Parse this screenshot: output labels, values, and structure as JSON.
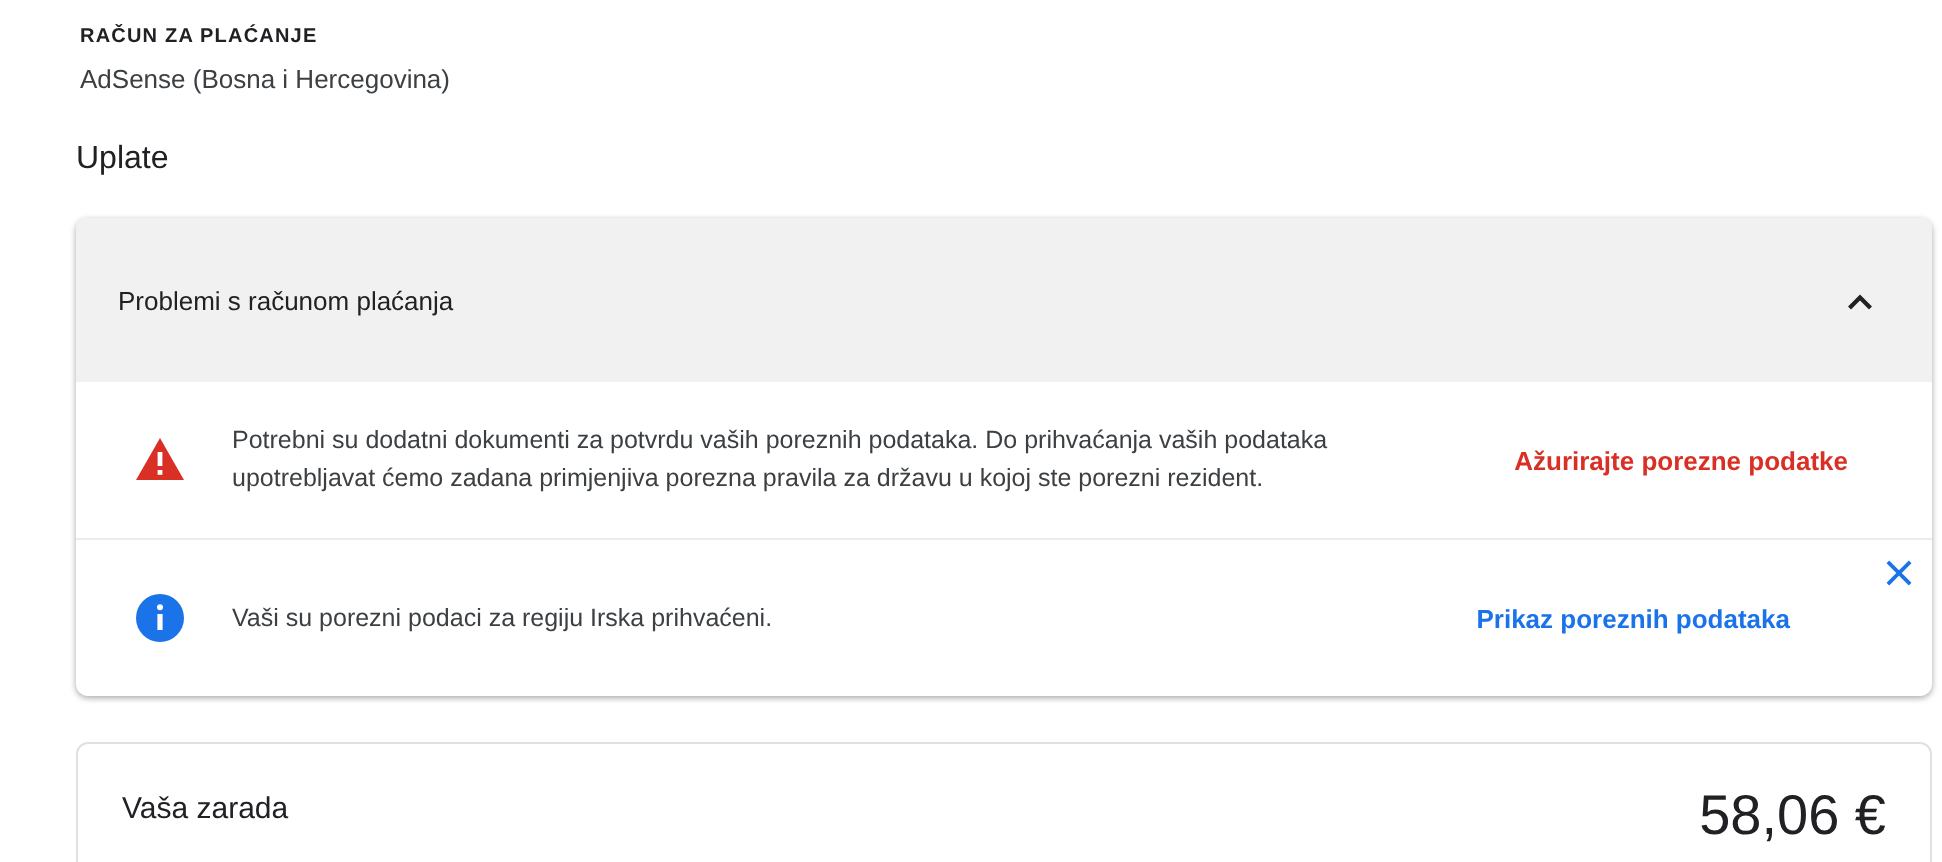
{
  "account": {
    "label": "RAČUN ZA PLAĆANJE",
    "name": "AdSense (Bosna i Hercegovina)"
  },
  "section_title": "Uplate",
  "issues_panel": {
    "title": "Problemi s računom plaćanja",
    "expanded": true,
    "alerts": [
      {
        "kind": "warning",
        "message": "Potrebni su dodatni dokumenti za potvrdu vaših poreznih podataka. Do prihvaćanja vaših podataka upotrebljavat ćemo zadana primjenjiva porezna pravila za državu u kojoj ste porezni rezident.",
        "action": "Ažurirajte porezne podatke",
        "dismissible": false
      },
      {
        "kind": "info",
        "message": "Vaši su porezni podaci za regiju Irska prihvaćeni.",
        "action": "Prikaz poreznih podataka",
        "dismissible": true
      }
    ]
  },
  "earnings": {
    "label": "Vaša zarada",
    "amount": "58,06 €"
  }
}
